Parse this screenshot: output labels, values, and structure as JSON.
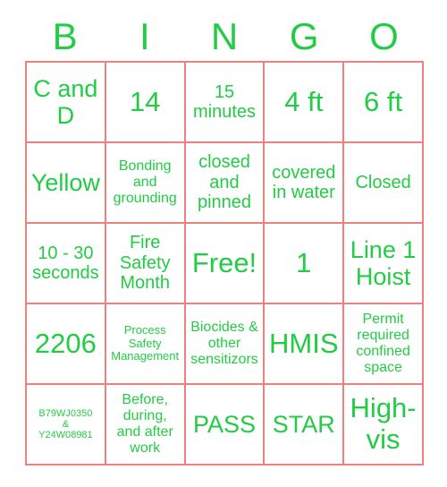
{
  "card": {
    "title": "BINGO Card",
    "text_color": "#22cc44",
    "border_color": "#f08080",
    "background_color": "#ffffff"
  },
  "header": {
    "letters": [
      "B",
      "I",
      "N",
      "G",
      "O"
    ]
  },
  "grid": {
    "columns": 5,
    "rows": 5,
    "cells": [
      {
        "text": "C and D",
        "size": "fs-lg"
      },
      {
        "text": "14",
        "size": "fs-xl"
      },
      {
        "text": "15\nminutes",
        "size": "fs-md"
      },
      {
        "text": "4 ft",
        "size": "fs-xl"
      },
      {
        "text": "6 ft",
        "size": "fs-xl"
      },
      {
        "text": "Yellow",
        "size": "fs-lg"
      },
      {
        "text": "Bonding\nand\ngrounding",
        "size": "fs-sm"
      },
      {
        "text": "closed\nand\npinned",
        "size": "fs-md"
      },
      {
        "text": "covered\nin water",
        "size": "fs-md"
      },
      {
        "text": "Closed",
        "size": "fs-md"
      },
      {
        "text": "10 - 30\nseconds",
        "size": "fs-md"
      },
      {
        "text": "Fire\nSafety\nMonth",
        "size": "fs-md"
      },
      {
        "text": "Free!",
        "size": "fs-xl"
      },
      {
        "text": "1",
        "size": "fs-xl"
      },
      {
        "text": "Line 1\nHoist",
        "size": "fs-lg"
      },
      {
        "text": "2206",
        "size": "fs-xl"
      },
      {
        "text": "Process\nSafety\nManagement",
        "size": "fs-xs"
      },
      {
        "text": "Biocides &\nother\nsensitizors",
        "size": "fs-sm"
      },
      {
        "text": "HMIS",
        "size": "fs-xl"
      },
      {
        "text": "Permit\nrequired\nconfined\nspace",
        "size": "fs-sm"
      },
      {
        "text": "B79WJ0350\n&\nY24W08981",
        "size": "fs-xxs"
      },
      {
        "text": "Before,\nduring,\nand after\nwork",
        "size": "fs-sm"
      },
      {
        "text": "PASS",
        "size": "fs-lg"
      },
      {
        "text": "STAR",
        "size": "fs-lg"
      },
      {
        "text": "High-\nvis",
        "size": "fs-xl"
      }
    ]
  }
}
